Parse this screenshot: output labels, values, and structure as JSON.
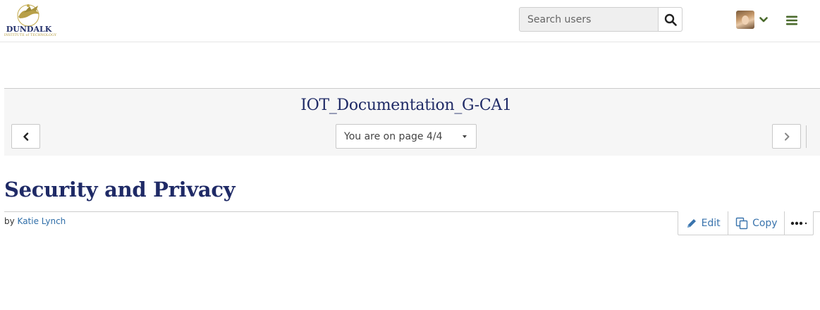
{
  "header": {
    "logo_word": "DUNDALK",
    "logo_sub": "INSTITUTE of TECHNOLOGY",
    "search_placeholder": "Search users"
  },
  "nav": {
    "doc_title": "IOT_Documentation_G-CA1",
    "page_select": "You are on page 4/4"
  },
  "page": {
    "title": "Security and Privacy",
    "by_prefix": "by",
    "author": "Katie Lynch"
  },
  "actions": {
    "edit": "Edit",
    "copy": "Copy"
  },
  "icons": {
    "search": "search-icon",
    "user_dropdown": "chevron-down-icon",
    "menu": "hamburger-menu-icon",
    "prev": "chevron-left-icon",
    "next": "chevron-right-icon",
    "edit": "pencil-icon",
    "copy": "copy-icon",
    "more": "more-dots-icon"
  },
  "colors": {
    "accent_green": "#4a6a2c",
    "title_navy": "#1f2a66",
    "link_blue": "#2f6ea8"
  }
}
